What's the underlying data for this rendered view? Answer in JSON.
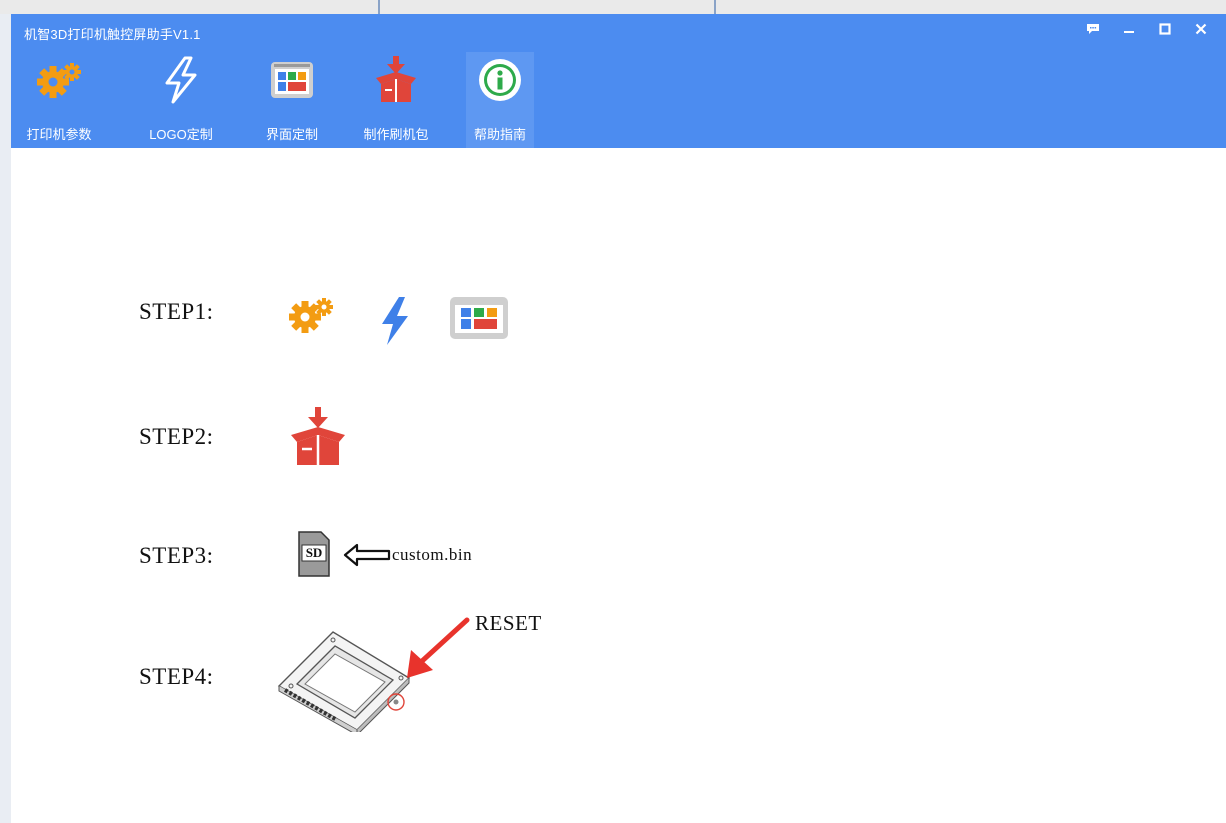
{
  "window": {
    "title": "机智3D打印机触控屏助手V1.1",
    "accent_color": "#4c8cf0",
    "controls": [
      {
        "icon": "feedback-icon"
      },
      {
        "icon": "minimize-icon"
      },
      {
        "icon": "maximize-icon"
      },
      {
        "icon": "close-icon"
      }
    ]
  },
  "toolbar": {
    "items": [
      {
        "label": "打印机参数",
        "icon": "gears-icon",
        "active": false
      },
      {
        "label": "LOGO定制",
        "icon": "lightning-icon",
        "active": false
      },
      {
        "label": "界面定制",
        "icon": "ui-layout-icon",
        "active": false
      },
      {
        "label": "制作刷机包",
        "icon": "package-box-icon",
        "active": false
      },
      {
        "label": "帮助指南",
        "icon": "info-icon",
        "active": true
      }
    ]
  },
  "help": {
    "steps": [
      {
        "label": "STEP1:",
        "icons": [
          "gears-icon",
          "lightning-icon",
          "ui-layout-icon"
        ]
      },
      {
        "label": "STEP2:",
        "icons": [
          "package-box-icon"
        ]
      },
      {
        "label": "STEP3:",
        "icons": [
          "sd-card-icon",
          "left-arrow-icon"
        ],
        "sd_text": "SD",
        "file": "custom.bin"
      },
      {
        "label": "STEP4:",
        "icons": [
          "touchscreen-board-icon",
          "red-arrow-icon"
        ],
        "note": "RESET"
      }
    ]
  }
}
